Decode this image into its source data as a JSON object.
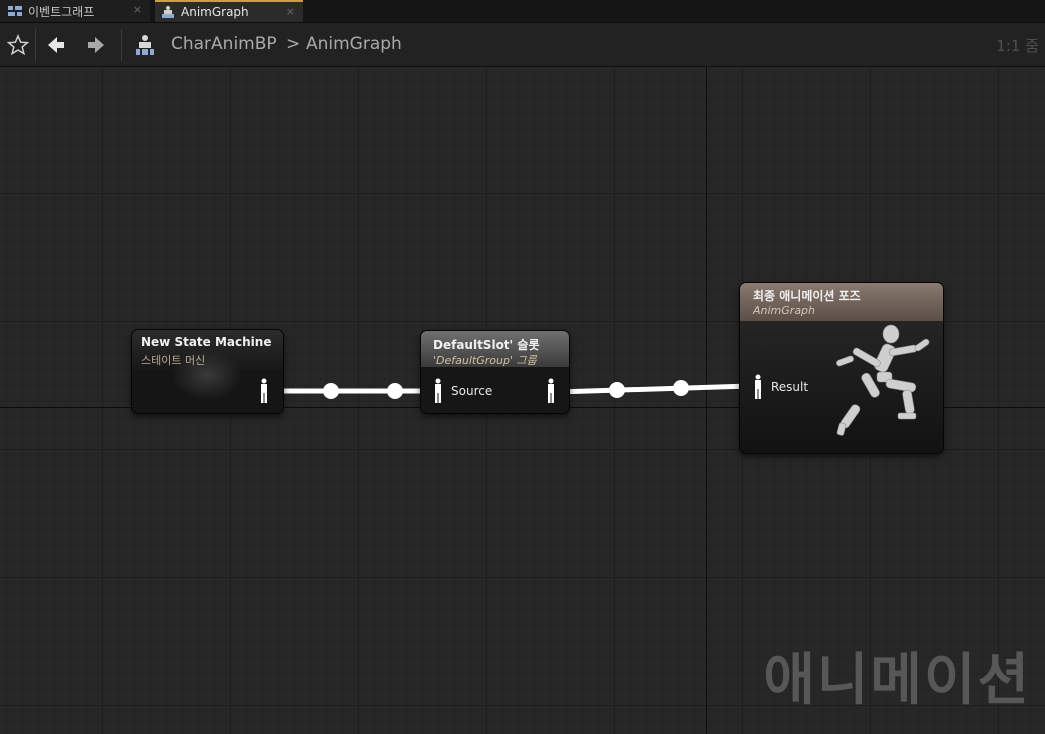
{
  "tabs": [
    {
      "label": "이벤트그래프",
      "icon": "event-graph-icon",
      "close": "×"
    },
    {
      "label": "AnimGraph",
      "icon": "anim-graph-icon",
      "close": "×"
    }
  ],
  "toolbar": {
    "breadcrumb_root": "CharAnimBP",
    "breadcrumb_sep": ">",
    "breadcrumb_current": "AnimGraph",
    "zoom": "1:1 줌"
  },
  "nodes": {
    "state_machine": {
      "title": "New State Machine",
      "subtitle": "스테이트 머신"
    },
    "slot": {
      "title": "DefaultSlot' 슬롯",
      "subtitle": "'DefaultGroup' 그룹",
      "input_label": "Source"
    },
    "output": {
      "title": "최종 애니메이션 포즈",
      "subtitle": "AnimGraph",
      "input_label": "Result"
    }
  },
  "watermark": "애니메이션",
  "colors": {
    "accent_tab": "#c9a33a",
    "wire": "#ffffff",
    "output_header": "#8a7a70"
  }
}
